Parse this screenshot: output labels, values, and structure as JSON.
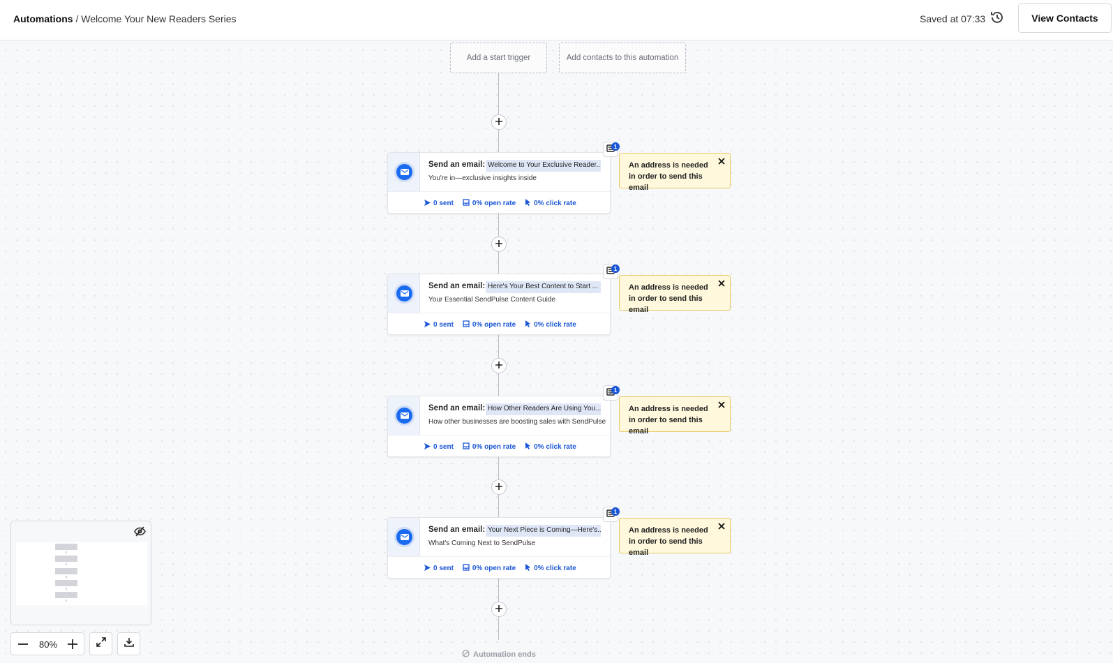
{
  "header": {
    "breadcrumb_root": "Automations",
    "breadcrumb_separator": " / ",
    "breadcrumb_current": "Welcome Your New Readers Series",
    "saved_text": "Saved at 07:33",
    "view_contacts_label": "View Contacts"
  },
  "triggers": {
    "start_trigger": "Add a start trigger",
    "add_contacts": "Add contacts to this automation"
  },
  "email_steps": [
    {
      "label": "Send an email:",
      "subject": "Welcome to Your Exclusive Reader...",
      "preview": "You're in—exclusive insights inside",
      "sent": "0 sent",
      "open_rate": "0% open rate",
      "click_rate": "0% click rate",
      "badge_count": "1",
      "warning": "An address is needed in order to send this email"
    },
    {
      "label": "Send an email:",
      "subject": "Here's Your Best Content to Start ...",
      "preview": "Your Essential SendPulse Content Guide",
      "sent": "0 sent",
      "open_rate": "0% open rate",
      "click_rate": "0% click rate",
      "badge_count": "1",
      "warning": "An address is needed in order to send this email"
    },
    {
      "label": "Send an email:",
      "subject": "How Other Readers Are Using You...",
      "preview": "How other businesses are boosting sales with SendPulse",
      "sent": "0 sent",
      "open_rate": "0% open rate",
      "click_rate": "0% click rate",
      "badge_count": "1",
      "warning": "An address is needed in order to send this email"
    },
    {
      "label": "Send an email:",
      "subject": "Your Next Piece is Coming—Here's...",
      "preview": "What's Coming Next to SendPulse",
      "sent": "0 sent",
      "open_rate": "0% open rate",
      "click_rate": "0% click rate",
      "badge_count": "1",
      "warning": "An address is needed in order to send this email"
    }
  ],
  "footer": {
    "automation_ends": "Automation ends"
  },
  "zoom": {
    "level": "80%"
  },
  "colors": {
    "accent": "#1a56d6",
    "warning_bg": "#fff8dc",
    "warning_border": "#e6c96a"
  },
  "icons": [
    "history-icon",
    "mail-icon",
    "send-icon",
    "open-icon",
    "cursor-icon",
    "close-icon",
    "plus-icon",
    "minimap-hide-icon",
    "expand-icon",
    "download-icon",
    "ban-icon"
  ]
}
